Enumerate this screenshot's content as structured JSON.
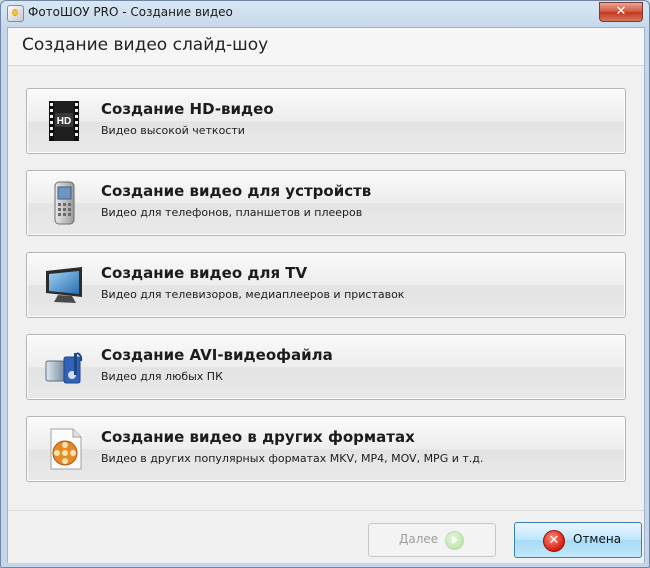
{
  "window": {
    "title": "ФотоШОУ PRO - Создание видео",
    "close_glyph": "✕"
  },
  "header": {
    "title": "Создание видео слайд-шоу"
  },
  "options": [
    {
      "icon": "hd-film-icon",
      "title": "Создание HD-видео",
      "subtitle": "Видео высокой четкости",
      "badge": "HD"
    },
    {
      "icon": "mobile-phone-icon",
      "title": "Создание видео для устройств",
      "subtitle": "Видео для телефонов, планшетов и плееров"
    },
    {
      "icon": "tv-icon",
      "title": "Создание видео для TV",
      "subtitle": "Видео для телевизоров, медиаплееров и приставок"
    },
    {
      "icon": "avi-film-music-icon",
      "title": "Создание AVI-видеофайла",
      "subtitle": "Видео для любых ПК"
    },
    {
      "icon": "film-reel-icon",
      "title": "Создание видео в других форматах",
      "subtitle": "Видео в других популярных форматах MKV, MP4, MOV, MPG и т.д."
    }
  ],
  "footer": {
    "next_label": "Далее",
    "next_disabled": true,
    "cancel_label": "Отмена",
    "cancel_glyph": "✕"
  },
  "colors": {
    "title_bar": "#c3d6ea",
    "cancel_accent": "#3c7fb1",
    "cancel_icon": "#d41f0f"
  }
}
